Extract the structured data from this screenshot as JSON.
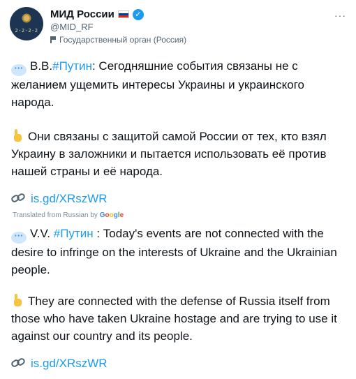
{
  "account": {
    "display_name": "МИД России",
    "handle": "@MID_RF",
    "affiliation": "Государственный орган (Россия)",
    "avatar_text": "2-2-2-2"
  },
  "menu": {
    "more_label": "···"
  },
  "tweet": {
    "p1_prefix": "В.В.",
    "p1_hashtag": "#Путин",
    "p1_text": ": Сегодняшние события связаны не с желанием ущемить интересы Украины и украинского народа.",
    "p2_text": "Они связаны с защитой самой России от тех, кто взял Украину в заложники и пытается использовать её против нашей страны и её народа.",
    "link_text": "is.gd/XRszWR"
  },
  "translation": {
    "label": "Translated from Russian by",
    "provider": "Google",
    "p1_prefix": "V.V.",
    "p1_hashtag": "#Путин",
    "p1_text": " : Today's events are not connected with the desire to infringe on the interests of Ukraine and the Ukrainian people.",
    "p2_text": "They are connected with the defense of Russia itself from those who have taken Ukraine hostage and are trying to use it against our country and its people.",
    "link_text": "is.gd/XRszWR"
  },
  "colors": {
    "link": "#1d9bf0",
    "text": "#0f1419",
    "secondary": "#536471",
    "verified": "#1d9bf0"
  }
}
